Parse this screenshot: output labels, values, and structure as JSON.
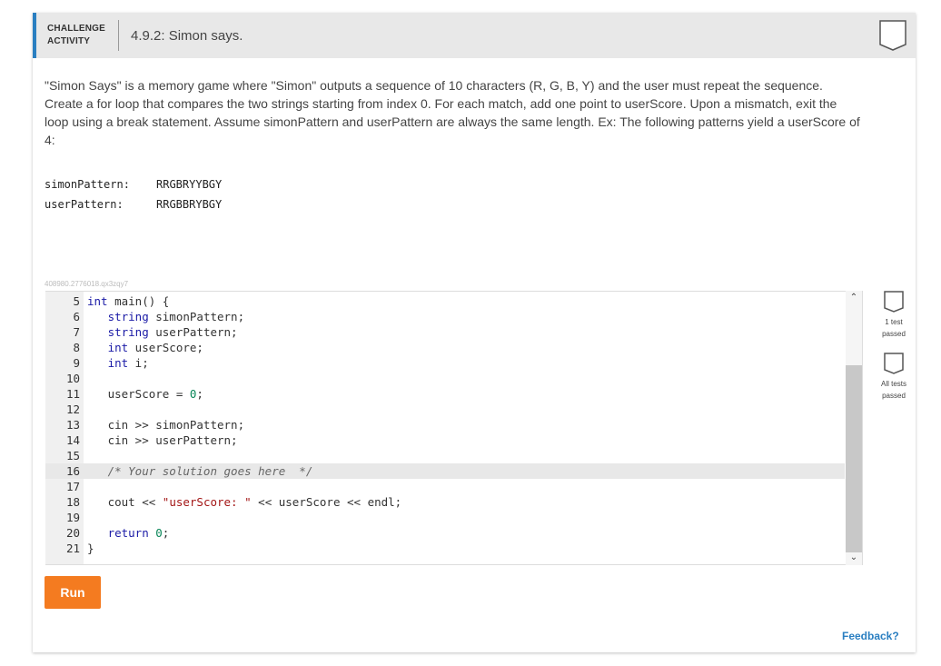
{
  "header": {
    "activity_type": "CHALLENGE ACTIVITY",
    "title": "4.9.2: Simon says."
  },
  "description": "\"Simon Says\" is a memory game where \"Simon\" outputs a sequence of 10 characters (R, G, B, Y) and the user must repeat the sequence. Create a for loop that compares the two strings starting from index 0. For each match, add one point to userScore. Upon a mismatch, exit the loop using a break statement. Assume simonPattern and userPattern are always the same length. Ex: The following patterns yield a userScore of 4:",
  "example": {
    "simon_label": "simonPattern:",
    "simon_value": "RRGBRYYBGY",
    "user_label": "userPattern:",
    "user_value": "RRGBBRYBGY"
  },
  "hash_id": "408980.2776018.qx3zqy7",
  "code": {
    "line_numbers": [
      "5",
      "6",
      "7",
      "8",
      "9",
      "10",
      "11",
      "12",
      "13",
      "14",
      "15",
      "16",
      "17",
      "18",
      "19",
      "20",
      "21"
    ],
    "lines": [
      "int main() {",
      "   string simonPattern;",
      "   string userPattern;",
      "   int userScore;",
      "   int i;",
      "",
      "   userScore = 0;",
      "",
      "   cin >> simonPattern;",
      "   cin >> userPattern;",
      "",
      "   /* Your solution goes here  */",
      "",
      "   cout << \"userScore: \" << userScore << endl;",
      "",
      "   return 0;",
      "}"
    ]
  },
  "status": {
    "test1_label": "1 test passed",
    "test2_label": "All tests passed"
  },
  "buttons": {
    "run_label": "Run",
    "feedback_label": "Feedback?"
  }
}
